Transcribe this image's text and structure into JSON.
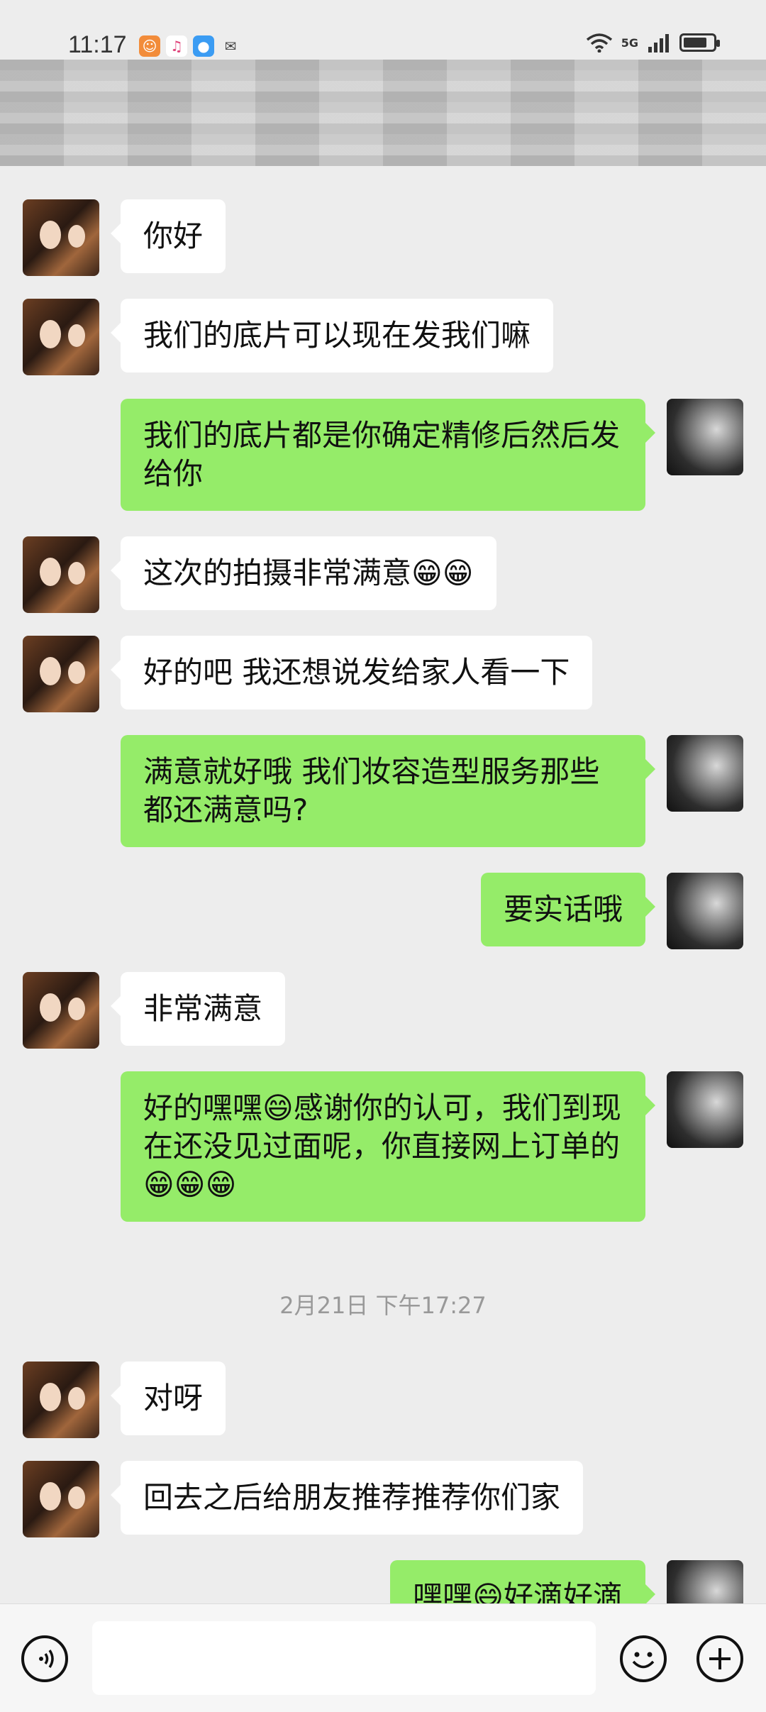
{
  "status_bar": {
    "time": "11:17",
    "network_label": "5G",
    "battery_percent": 80
  },
  "messages": [
    {
      "sender": "friend",
      "text": "你好"
    },
    {
      "sender": "friend",
      "text": "我们的底片可以现在发我们嘛"
    },
    {
      "sender": "me",
      "text": "我们的底片都是你确定精修后然后发给你"
    },
    {
      "sender": "friend",
      "text": "这次的拍摄非常满意😁😁"
    },
    {
      "sender": "friend",
      "text": "好的吧  我还想说发给家人看一下"
    },
    {
      "sender": "me",
      "text": "满意就好哦  我们妆容造型服务那些都还满意吗?"
    },
    {
      "sender": "me",
      "text": "要实话哦"
    },
    {
      "sender": "friend",
      "text": "非常满意"
    },
    {
      "sender": "me",
      "text": "好的嘿嘿😄感谢你的认可，我们到现在还没见过面呢，你直接网上订单的😁😁😁"
    },
    {
      "sender": "friend",
      "text": "对呀"
    },
    {
      "sender": "friend",
      "text": "回去之后给朋友推荐推荐你们家"
    },
    {
      "sender": "me",
      "text": "嘿嘿😄好滴好滴"
    }
  ],
  "timestamp": "2月21日 下午17:27",
  "input_bar": {
    "voice_icon": "voice-icon",
    "emoji_icon": "emoji-icon",
    "plus_icon": "plus-icon"
  },
  "colors": {
    "sent_bubble": "#95ec69",
    "received_bubble": "#ffffff",
    "background": "#ededed"
  }
}
